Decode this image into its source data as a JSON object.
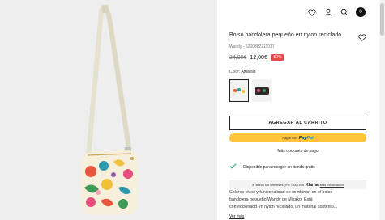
{
  "header": {
    "icons": [
      "heart-icon",
      "user-icon",
      "search-icon",
      "bag-icon"
    ],
    "bag_count": "0"
  },
  "product": {
    "title": "Bolso bandolera pequeño en nylon reciclado",
    "sku": "Wandy - 5200382211017",
    "old_price": "24,99€",
    "new_price": "12,00€",
    "discount": "-52%"
  },
  "color": {
    "label": "Color:",
    "value": "Amarillo"
  },
  "buttons": {
    "add_to_cart": "AGREGAR AL CARRITO",
    "paypal_prefix": "Pagar con",
    "paypal_brand_a": "Pay",
    "paypal_brand_b": "Pal"
  },
  "payment": {
    "more_options": "Más opciones de pago"
  },
  "store": {
    "availability": "Disponible para recoger en tienda gratis"
  },
  "klarna": {
    "text": "3 plazos sin intereses (0% TAE) con",
    "brand": "Klarna",
    "link": "Más información"
  },
  "description": {
    "line1": "Colores vivos y funcionalidad se combinan en el bolso",
    "line2": "bandolera pequeño Wandy de Misako. Está",
    "line3": "confeccionado en nylon reciclado, un material sostenib...",
    "see_more": "Ver más"
  },
  "colors": {
    "accent": "#222222",
    "discount": "#e74a4a",
    "paypal": "#ffc439",
    "check": "#2db36f"
  }
}
